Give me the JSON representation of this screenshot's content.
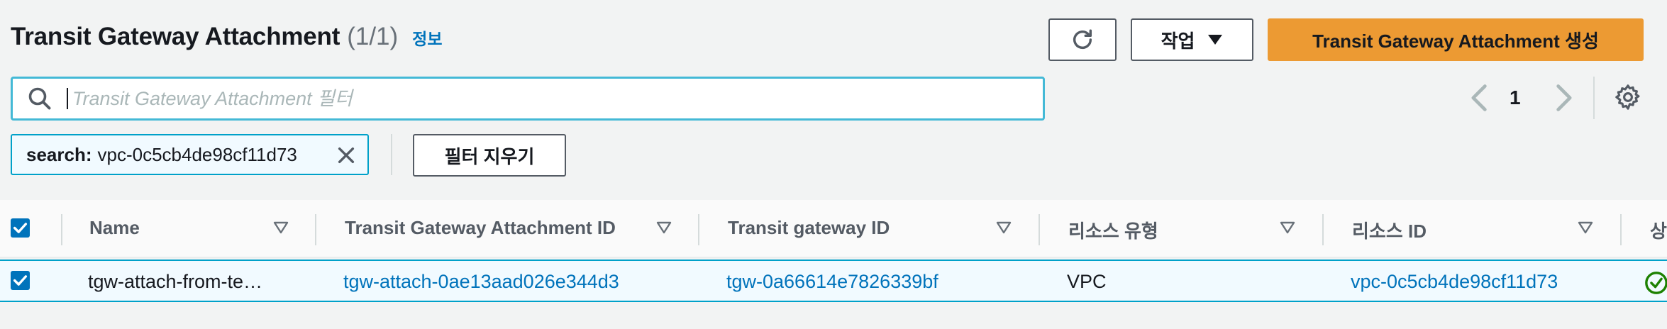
{
  "header": {
    "title": "Transit Gateway Attachment",
    "count": "(1/1)",
    "info_link": "정보",
    "actions_label": "작업",
    "create_label": "Transit Gateway Attachment 생성"
  },
  "search": {
    "placeholder": "Transit Gateway Attachment 필터",
    "value": ""
  },
  "pagination": {
    "current_page": "1"
  },
  "filter_token": {
    "key": "search:",
    "value": "vpc-0c5cb4de98cf11d73"
  },
  "clear_filters_label": "필터 지우기",
  "table": {
    "columns": [
      "Name",
      "Transit Gateway Attachment ID",
      "Transit gateway ID",
      "리소스 유형",
      "리소스 ID",
      "상"
    ],
    "rows": [
      {
        "name": "tgw-attach-from-te…",
        "attachment_id": "tgw-attach-0ae13aad026e344d3",
        "tgw_id": "tgw-0a66614e7826339bf",
        "resource_type": "VPC",
        "resource_id": "vpc-0c5cb4de98cf11d73",
        "selected": true
      }
    ]
  },
  "colors": {
    "primary": "#ec9a33",
    "link": "#0073bb",
    "focus": "#44b9d6",
    "success": "#1d8102"
  }
}
